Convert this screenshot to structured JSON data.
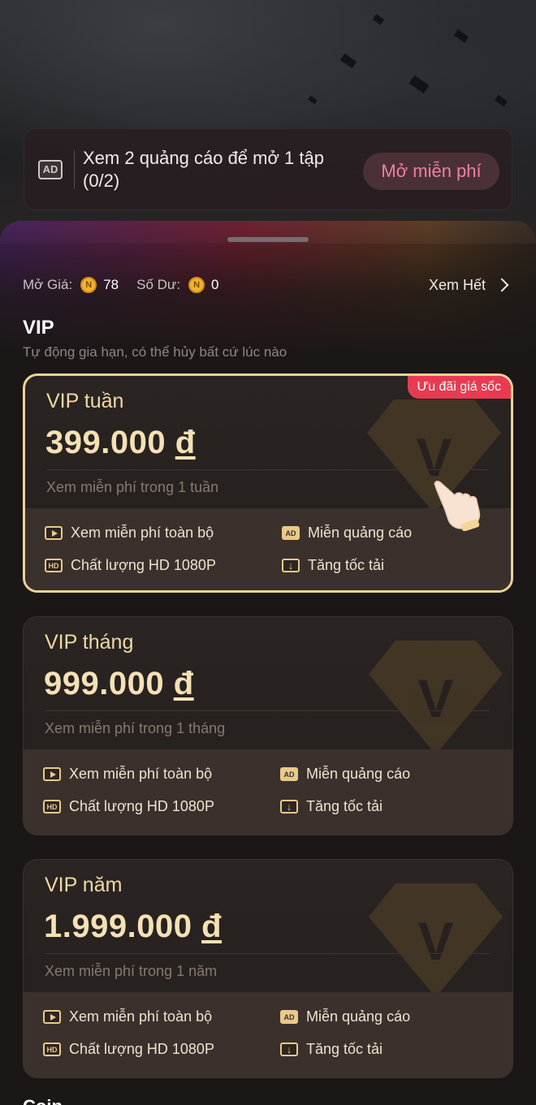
{
  "ad_banner": {
    "icon": "AD",
    "text": "Xem 2 quảng cáo để mở 1 tập (0/2)",
    "button_label": "Mở miễn phí"
  },
  "info": {
    "unlock_label": "Mở Giá:",
    "unlock_value": "78",
    "balance_label": "Số Dư:",
    "balance_value": "0",
    "coin_symbol": "N",
    "see_all_label": "Xem Hết"
  },
  "vip": {
    "title": "VIP",
    "subtitle": "Tự động gia hạn, có thể hủy bất cứ lúc nào"
  },
  "plans": [
    {
      "name": "VIP tuần",
      "price": "399.000",
      "currency": "đ",
      "desc": "Xem miễn phí trong 1 tuần",
      "badge": "Ưu đãi giá sốc",
      "selected": true
    },
    {
      "name": "VIP tháng",
      "price": "999.000",
      "currency": "đ",
      "desc": "Xem miễn phí trong 1 tháng",
      "selected": false
    },
    {
      "name": "VIP năm",
      "price": "1.999.000",
      "currency": "đ",
      "desc": "Xem miễn phí trong 1 năm",
      "selected": false
    }
  ],
  "benefits": {
    "free_all": "Xem miễn phí toàn bộ",
    "no_ads": "Miễn quảng cáo",
    "hd": "Chất lượng HD 1080P",
    "speed": "Tăng tốc tải",
    "hd_icon": "HD",
    "ad_icon": "AD"
  },
  "next_section_peek": "Coin",
  "colors": {
    "accent_gold": "#f2d9a4",
    "badge_red": "#e83b52",
    "button_pink": "#f27fa0"
  }
}
